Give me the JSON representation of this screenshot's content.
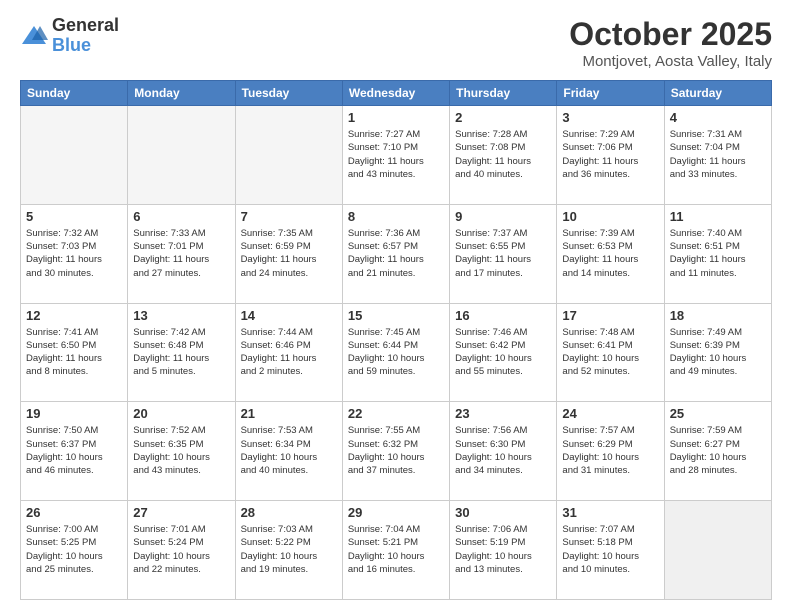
{
  "header": {
    "logo": {
      "general": "General",
      "blue": "Blue"
    },
    "title": "October 2025",
    "location": "Montjovet, Aosta Valley, Italy"
  },
  "weekdays": [
    "Sunday",
    "Monday",
    "Tuesday",
    "Wednesday",
    "Thursday",
    "Friday",
    "Saturday"
  ],
  "rows": [
    [
      {
        "day": "",
        "empty": true
      },
      {
        "day": "",
        "empty": true
      },
      {
        "day": "",
        "empty": true
      },
      {
        "day": "1",
        "lines": [
          "Sunrise: 7:27 AM",
          "Sunset: 7:10 PM",
          "Daylight: 11 hours",
          "and 43 minutes."
        ]
      },
      {
        "day": "2",
        "lines": [
          "Sunrise: 7:28 AM",
          "Sunset: 7:08 PM",
          "Daylight: 11 hours",
          "and 40 minutes."
        ]
      },
      {
        "day": "3",
        "lines": [
          "Sunrise: 7:29 AM",
          "Sunset: 7:06 PM",
          "Daylight: 11 hours",
          "and 36 minutes."
        ]
      },
      {
        "day": "4",
        "lines": [
          "Sunrise: 7:31 AM",
          "Sunset: 7:04 PM",
          "Daylight: 11 hours",
          "and 33 minutes."
        ]
      }
    ],
    [
      {
        "day": "5",
        "lines": [
          "Sunrise: 7:32 AM",
          "Sunset: 7:03 PM",
          "Daylight: 11 hours",
          "and 30 minutes."
        ]
      },
      {
        "day": "6",
        "lines": [
          "Sunrise: 7:33 AM",
          "Sunset: 7:01 PM",
          "Daylight: 11 hours",
          "and 27 minutes."
        ]
      },
      {
        "day": "7",
        "lines": [
          "Sunrise: 7:35 AM",
          "Sunset: 6:59 PM",
          "Daylight: 11 hours",
          "and 24 minutes."
        ]
      },
      {
        "day": "8",
        "lines": [
          "Sunrise: 7:36 AM",
          "Sunset: 6:57 PM",
          "Daylight: 11 hours",
          "and 21 minutes."
        ]
      },
      {
        "day": "9",
        "lines": [
          "Sunrise: 7:37 AM",
          "Sunset: 6:55 PM",
          "Daylight: 11 hours",
          "and 17 minutes."
        ]
      },
      {
        "day": "10",
        "lines": [
          "Sunrise: 7:39 AM",
          "Sunset: 6:53 PM",
          "Daylight: 11 hours",
          "and 14 minutes."
        ]
      },
      {
        "day": "11",
        "lines": [
          "Sunrise: 7:40 AM",
          "Sunset: 6:51 PM",
          "Daylight: 11 hours",
          "and 11 minutes."
        ]
      }
    ],
    [
      {
        "day": "12",
        "lines": [
          "Sunrise: 7:41 AM",
          "Sunset: 6:50 PM",
          "Daylight: 11 hours",
          "and 8 minutes."
        ]
      },
      {
        "day": "13",
        "lines": [
          "Sunrise: 7:42 AM",
          "Sunset: 6:48 PM",
          "Daylight: 11 hours",
          "and 5 minutes."
        ]
      },
      {
        "day": "14",
        "lines": [
          "Sunrise: 7:44 AM",
          "Sunset: 6:46 PM",
          "Daylight: 11 hours",
          "and 2 minutes."
        ]
      },
      {
        "day": "15",
        "lines": [
          "Sunrise: 7:45 AM",
          "Sunset: 6:44 PM",
          "Daylight: 10 hours",
          "and 59 minutes."
        ]
      },
      {
        "day": "16",
        "lines": [
          "Sunrise: 7:46 AM",
          "Sunset: 6:42 PM",
          "Daylight: 10 hours",
          "and 55 minutes."
        ]
      },
      {
        "day": "17",
        "lines": [
          "Sunrise: 7:48 AM",
          "Sunset: 6:41 PM",
          "Daylight: 10 hours",
          "and 52 minutes."
        ]
      },
      {
        "day": "18",
        "lines": [
          "Sunrise: 7:49 AM",
          "Sunset: 6:39 PM",
          "Daylight: 10 hours",
          "and 49 minutes."
        ]
      }
    ],
    [
      {
        "day": "19",
        "lines": [
          "Sunrise: 7:50 AM",
          "Sunset: 6:37 PM",
          "Daylight: 10 hours",
          "and 46 minutes."
        ]
      },
      {
        "day": "20",
        "lines": [
          "Sunrise: 7:52 AM",
          "Sunset: 6:35 PM",
          "Daylight: 10 hours",
          "and 43 minutes."
        ]
      },
      {
        "day": "21",
        "lines": [
          "Sunrise: 7:53 AM",
          "Sunset: 6:34 PM",
          "Daylight: 10 hours",
          "and 40 minutes."
        ]
      },
      {
        "day": "22",
        "lines": [
          "Sunrise: 7:55 AM",
          "Sunset: 6:32 PM",
          "Daylight: 10 hours",
          "and 37 minutes."
        ]
      },
      {
        "day": "23",
        "lines": [
          "Sunrise: 7:56 AM",
          "Sunset: 6:30 PM",
          "Daylight: 10 hours",
          "and 34 minutes."
        ]
      },
      {
        "day": "24",
        "lines": [
          "Sunrise: 7:57 AM",
          "Sunset: 6:29 PM",
          "Daylight: 10 hours",
          "and 31 minutes."
        ]
      },
      {
        "day": "25",
        "lines": [
          "Sunrise: 7:59 AM",
          "Sunset: 6:27 PM",
          "Daylight: 10 hours",
          "and 28 minutes."
        ]
      }
    ],
    [
      {
        "day": "26",
        "lines": [
          "Sunrise: 7:00 AM",
          "Sunset: 5:25 PM",
          "Daylight: 10 hours",
          "and 25 minutes."
        ]
      },
      {
        "day": "27",
        "lines": [
          "Sunrise: 7:01 AM",
          "Sunset: 5:24 PM",
          "Daylight: 10 hours",
          "and 22 minutes."
        ]
      },
      {
        "day": "28",
        "lines": [
          "Sunrise: 7:03 AM",
          "Sunset: 5:22 PM",
          "Daylight: 10 hours",
          "and 19 minutes."
        ]
      },
      {
        "day": "29",
        "lines": [
          "Sunrise: 7:04 AM",
          "Sunset: 5:21 PM",
          "Daylight: 10 hours",
          "and 16 minutes."
        ]
      },
      {
        "day": "30",
        "lines": [
          "Sunrise: 7:06 AM",
          "Sunset: 5:19 PM",
          "Daylight: 10 hours",
          "and 13 minutes."
        ]
      },
      {
        "day": "31",
        "lines": [
          "Sunrise: 7:07 AM",
          "Sunset: 5:18 PM",
          "Daylight: 10 hours",
          "and 10 minutes."
        ]
      },
      {
        "day": "",
        "empty": true
      }
    ]
  ]
}
